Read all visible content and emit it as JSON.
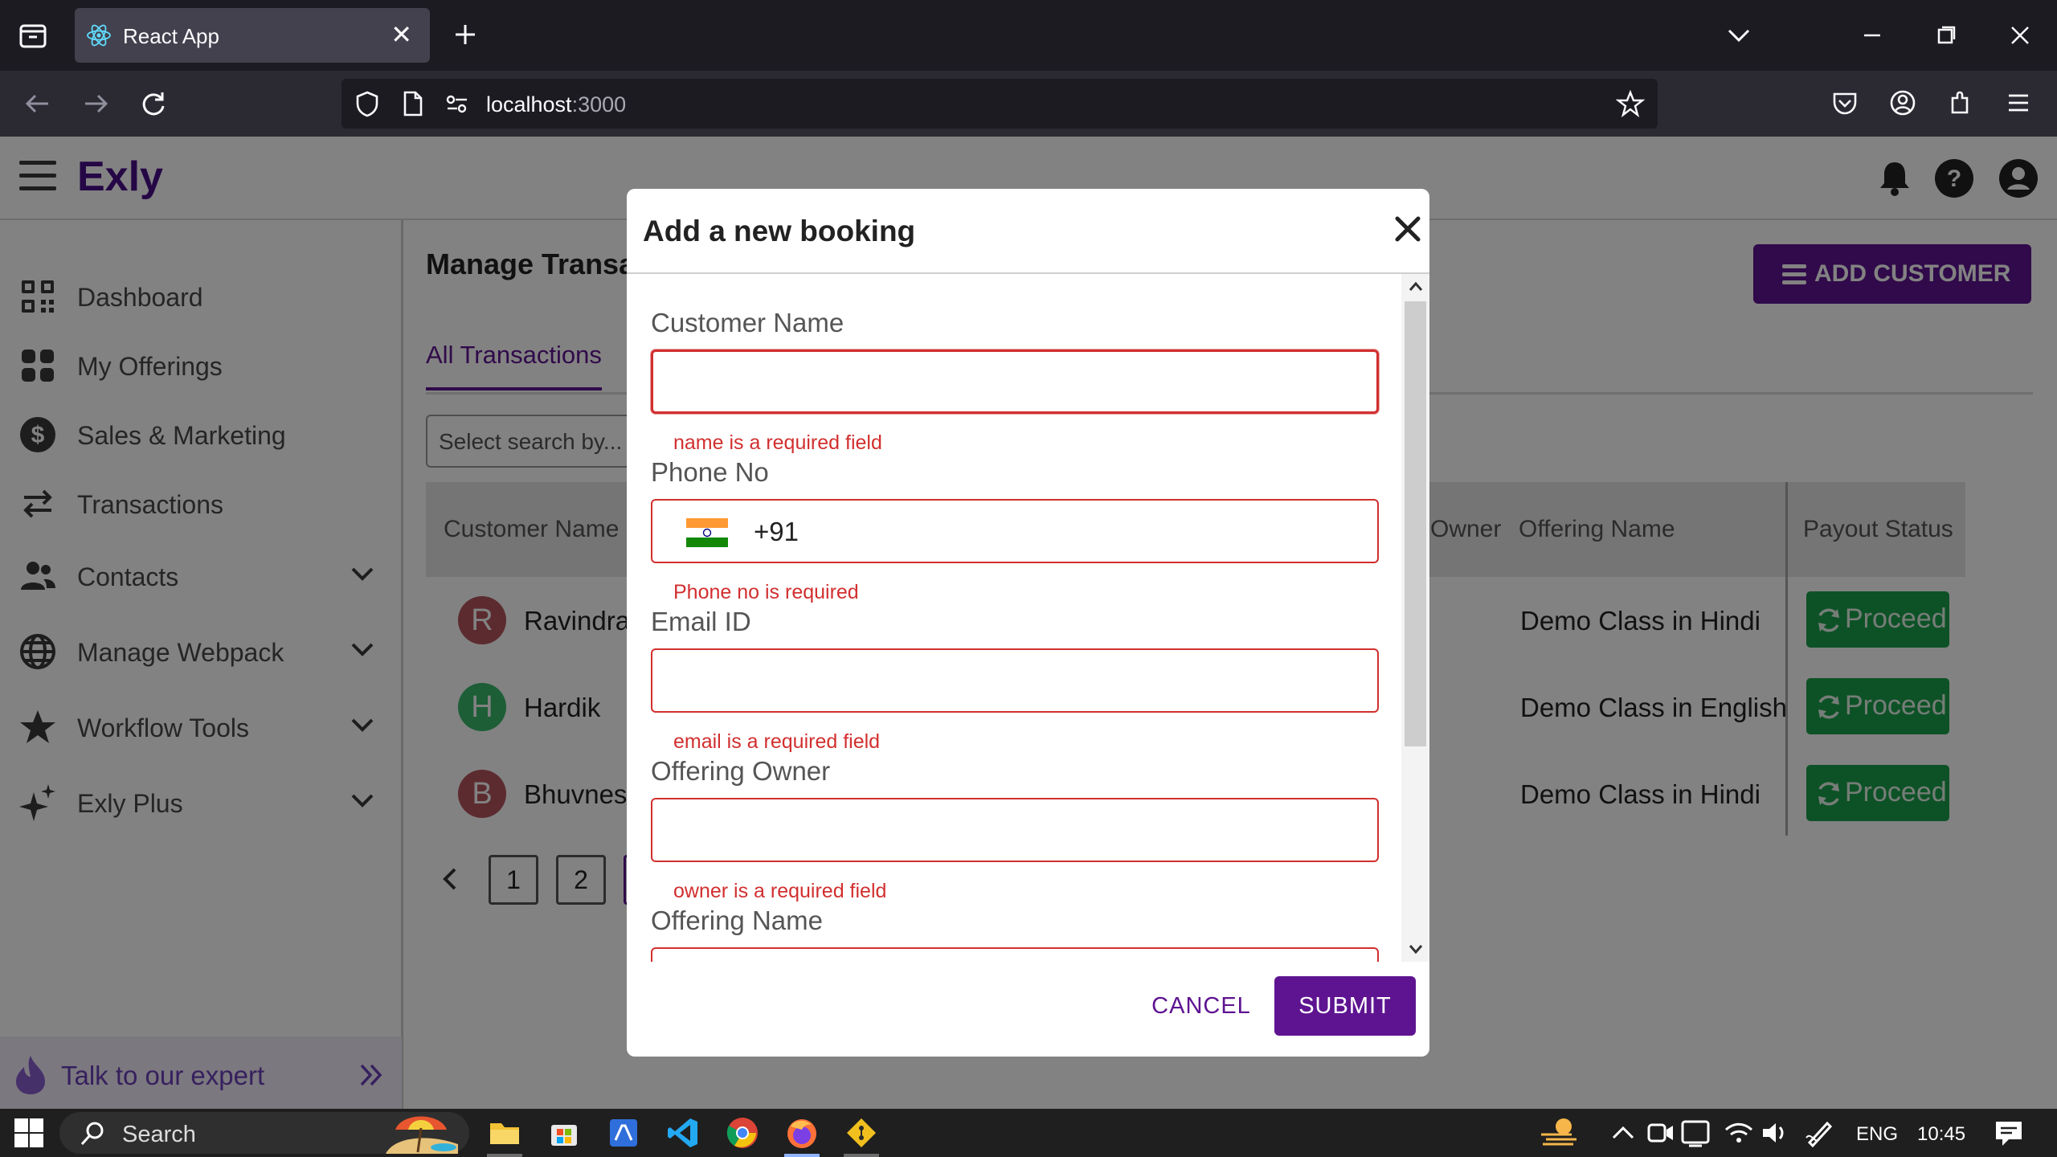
{
  "browser": {
    "tab_title": "React App",
    "url_host": "localhost",
    "url_port": ":3000"
  },
  "app": {
    "brand": "Exly",
    "sidebar": {
      "items": [
        {
          "label": "Dashboard",
          "icon": "qr-code-icon",
          "has_submenu": false
        },
        {
          "label": "My Offerings",
          "icon": "grid-icon",
          "has_submenu": false
        },
        {
          "label": "Sales & Marketing",
          "icon": "dollar-icon",
          "has_submenu": false
        },
        {
          "label": "Transactions",
          "icon": "swap-arrows-icon",
          "has_submenu": false
        },
        {
          "label": "Contacts",
          "icon": "people-icon",
          "has_submenu": true
        },
        {
          "label": "Manage Webpack",
          "icon": "globe-icon",
          "has_submenu": true
        },
        {
          "label": "Workflow Tools",
          "icon": "star-icon",
          "has_submenu": true
        },
        {
          "label": "Exly Plus",
          "icon": "sparkles-icon",
          "has_submenu": true
        }
      ],
      "expert_label": "Talk to our expert"
    },
    "page_title": "Manage Transa",
    "add_customer_label": "ADD CUSTOMER",
    "tabs": [
      {
        "label": "All Transactions",
        "active": true
      }
    ],
    "search_placeholder": "Select search by...",
    "table": {
      "headers": {
        "customer_name": "Customer Name",
        "owner": "Owner",
        "offering_name": "Offering Name",
        "payout_status": "Payout Status"
      },
      "rows": [
        {
          "initial": "R",
          "customer": "Ravindra",
          "offering": "Demo Class in Hindi",
          "action": "Proceed",
          "avatar_color": "#b5555e"
        },
        {
          "initial": "H",
          "customer": "Hardik",
          "offering": "Demo Class in English",
          "action": "Proceed",
          "avatar_color": "#39b86c"
        },
        {
          "initial": "B",
          "customer": "Bhuvnesh",
          "offering": "Demo Class in Hindi",
          "action": "Proceed",
          "avatar_color": "#b5555e"
        }
      ]
    },
    "pagination": {
      "pages": [
        "1",
        "2"
      ]
    }
  },
  "dialog": {
    "title": "Add a new booking",
    "fields": [
      {
        "label": "Customer Name",
        "value": "",
        "error": "name is a required field"
      },
      {
        "label": "Phone No",
        "value": "+91",
        "error": "Phone no is required"
      },
      {
        "label": "Email ID",
        "value": "",
        "error": "email is a required field"
      },
      {
        "label": "Offering Owner",
        "value": "",
        "error": "owner is a required field"
      },
      {
        "label": "Offering Name",
        "value": "",
        "error": ""
      }
    ],
    "cancel_label": "CANCEL",
    "submit_label": "SUBMIT"
  },
  "taskbar": {
    "search_label": "Search",
    "language": "ENG",
    "time": "10:45"
  },
  "colors": {
    "brand_purple": "#5e1491",
    "error_red": "#d22f2f",
    "proceed_green": "#1aa14c"
  }
}
